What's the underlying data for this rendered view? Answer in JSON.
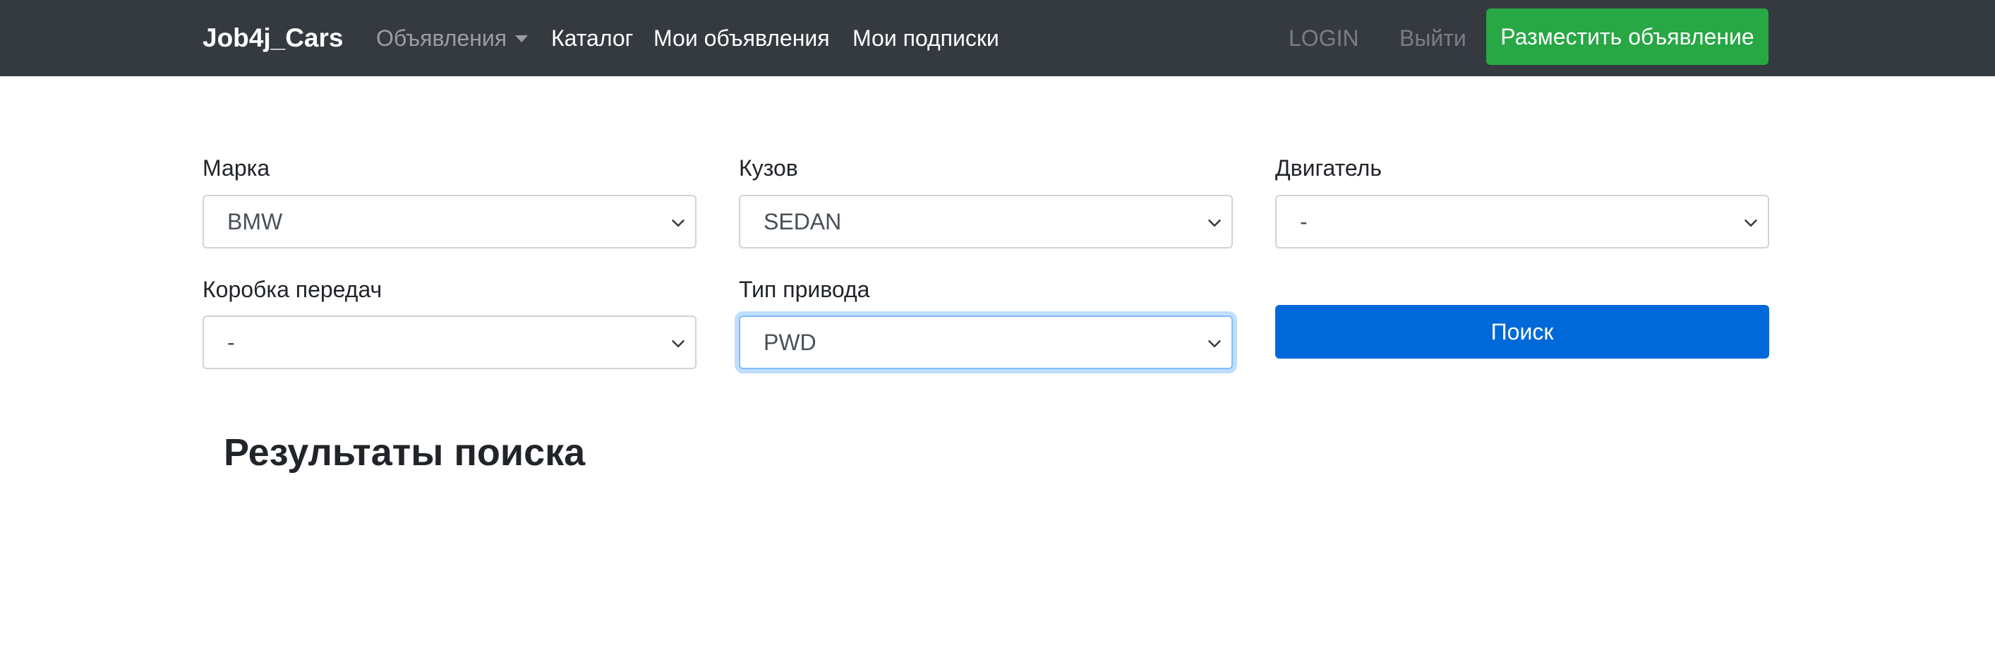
{
  "navbar": {
    "brand": "Job4j_Cars",
    "ads_dropdown": "Объявления",
    "catalog": "Каталог",
    "my_ads": "Мои объявления",
    "my_subscriptions": "Мои подписки",
    "login": "LOGIN",
    "logout": "Выйти",
    "post_ad_button": "Разместить объявление"
  },
  "filters": {
    "brand": {
      "label": "Марка",
      "value": "BMW"
    },
    "body": {
      "label": "Кузов",
      "value": "SEDAN"
    },
    "engine": {
      "label": "Двигатель",
      "value": "-"
    },
    "transmission": {
      "label": "Коробка передач",
      "value": "-"
    },
    "drive": {
      "label": "Тип привода",
      "value": "PWD"
    },
    "search_button": "Поиск"
  },
  "results": {
    "title": "Результаты поиска"
  },
  "colors": {
    "navbar_bg": "#343a40",
    "success": "#28a745",
    "primary": "#0069d9",
    "focus_border": "#80bdff"
  },
  "icons": {
    "dropdown_caret": "caret-down-icon",
    "select_chevron": "chevron-down-icon"
  }
}
